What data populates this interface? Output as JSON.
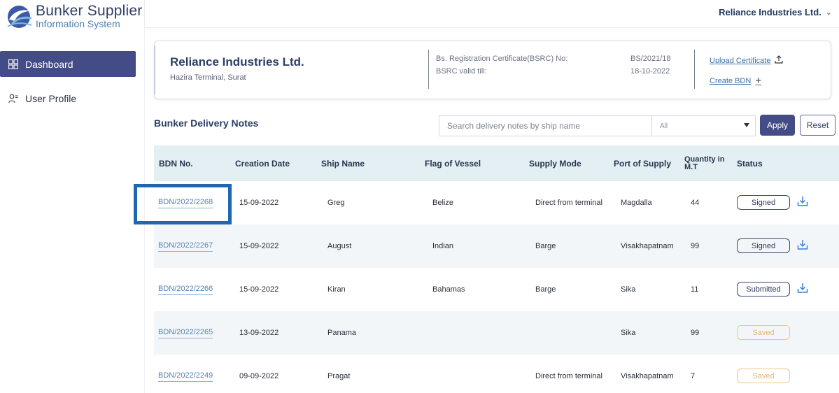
{
  "app": {
    "logo_title": "Bunker Supplier",
    "logo_subtitle": "Information System"
  },
  "sidebar": {
    "items": [
      {
        "label": "Dashboard",
        "icon": "dashboard-grid-icon",
        "active": true
      },
      {
        "label": "User Profile",
        "icon": "user-profile-icon",
        "active": false
      }
    ]
  },
  "header": {
    "company_menu_label": "Reliance Industries Ltd."
  },
  "info_card": {
    "company_name": "Reliance Industries Ltd.",
    "location": "Hazira Terminal, Surat",
    "bsrc_label": "Bs. Registration Certificate(BSRC) No:",
    "bsrc_value": "BS/2021/18",
    "valid_label": "BSRC valid till:",
    "valid_value": "18-10-2022",
    "upload_label": "Upload Certificate",
    "create_label": "Create BDN"
  },
  "section": {
    "title": "Bunker Delivery Notes",
    "search_placeholder": "Search delivery notes by ship name",
    "filter_value": "All",
    "apply_label": "Apply",
    "reset_label": "Reset"
  },
  "table": {
    "columns": [
      "BDN No.",
      "Creation Date",
      "Ship Name",
      "Flag of Vessel",
      "Supply Mode",
      "Port of Supply",
      "Quantity in M.T",
      "Status"
    ],
    "rows": [
      {
        "bdn": "BDN/2022/2268",
        "date": "15-09-2022",
        "ship": "Greg",
        "flag": "Belize",
        "mode": "Direct from terminal",
        "port": "Magdalla",
        "qty": "44",
        "status": "Signed",
        "downloadable": true
      },
      {
        "bdn": "BDN/2022/2267",
        "date": "15-09-2022",
        "ship": "August",
        "flag": "Indian",
        "mode": "Barge",
        "port": "Visakhapatnam",
        "qty": "99",
        "status": "Signed",
        "downloadable": true
      },
      {
        "bdn": "BDN/2022/2266",
        "date": "15-09-2022",
        "ship": "Kiran",
        "flag": "Bahamas",
        "mode": "Barge",
        "port": "Sika",
        "qty": "11",
        "status": "Submitted",
        "downloadable": true
      },
      {
        "bdn": "BDN/2022/2265",
        "date": "13-09-2022",
        "ship": "Panama",
        "flag": "",
        "mode": "",
        "port": "Sika",
        "qty": "99",
        "status": "Saved",
        "downloadable": false
      },
      {
        "bdn": "BDN/2022/2249",
        "date": "09-09-2022",
        "ship": "Pragat",
        "flag": "",
        "mode": "Direct from terminal",
        "port": "Visakhapatnam",
        "qty": "7",
        "status": "Saved",
        "downloadable": false
      }
    ]
  },
  "colors": {
    "primary": "#434c86",
    "link": "#5a82b5",
    "header_bg": "#e3eff3",
    "saved": "#eab56a",
    "highlight": "#1f66b3"
  }
}
